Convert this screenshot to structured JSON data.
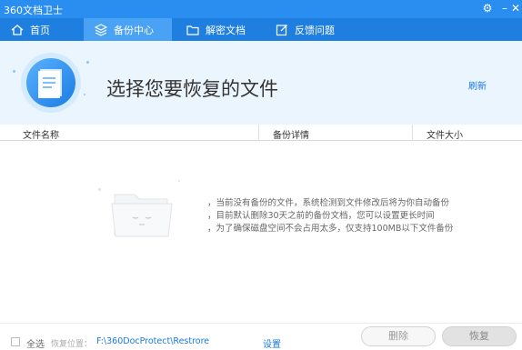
{
  "app_title": "360文档卫士",
  "window_controls": {
    "settings_glyph": "⚙",
    "minimize_glyph": "–",
    "close_glyph": "✕"
  },
  "nav": {
    "tabs": [
      {
        "label": "首页",
        "icon": "home-icon",
        "active": false
      },
      {
        "label": "备份中心",
        "icon": "layers-icon",
        "active": true
      },
      {
        "label": "解密文档",
        "icon": "folder-icon",
        "active": false
      },
      {
        "label": "反馈问题",
        "icon": "edit-icon",
        "active": false
      }
    ]
  },
  "header": {
    "title": "选择您要恢复的文件",
    "refresh_label": "刷新",
    "icon": "document-icon"
  },
  "columns": [
    "文件名称",
    "备份详情",
    "文件大小"
  ],
  "empty_state": {
    "icon": "empty-folder-icon",
    "lines": [
      "，当前没有备份的文件，系统检测到文件修改后将为你自动备份",
      "，目前默认删除30天之前的备份文档，您可以设置更长时间",
      "，为了确保磁盘空间不会占用太多，仅支持100MB以下文件备份"
    ]
  },
  "footer": {
    "select_all_label": "全选",
    "select_all_checked": false,
    "location_label": "恢复位置：",
    "location_path": "F:\\360DocProtect\\Restrore",
    "settings_label": "设置",
    "delete_label": "删除",
    "restore_label": "恢复"
  },
  "colors": {
    "titlebar": "#2a8ef0",
    "navbar": "#1f7fe0",
    "active_tab": "#4aa2f4",
    "header_bg": "#ebf5fd",
    "link": "#1a7be0"
  }
}
